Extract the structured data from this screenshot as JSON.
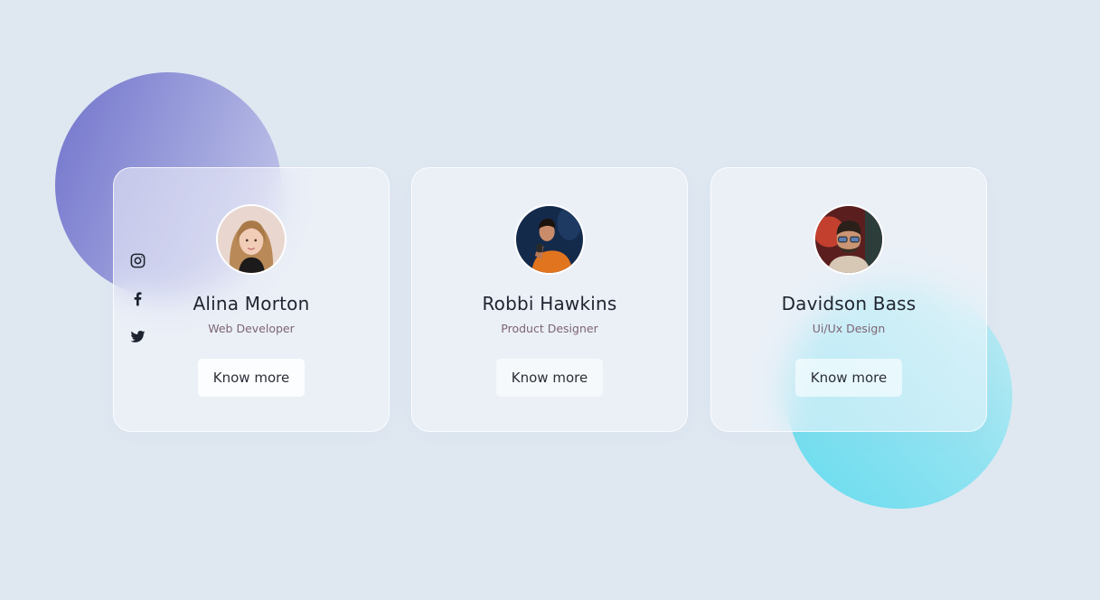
{
  "colors": {
    "background": "#dfe8f1",
    "purple_blob": "#7a7ccf",
    "cyan_blob": "#66dcee",
    "name_text": "#1f2530",
    "role_text": "#7d6473"
  },
  "social_icons": [
    "instagram-icon",
    "facebook-icon",
    "twitter-icon"
  ],
  "cards": [
    {
      "name": "Alina Morton",
      "role": "Web Developer",
      "button": "Know more",
      "avatar": "avatar-woman-blonde"
    },
    {
      "name": "Robbi Hawkins",
      "role": "Product Designer",
      "button": "Know more",
      "avatar": "avatar-man-orange-shirt"
    },
    {
      "name": "Davidson Bass",
      "role": "Ui/Ux Design",
      "button": "Know more",
      "avatar": "avatar-man-glasses"
    }
  ]
}
